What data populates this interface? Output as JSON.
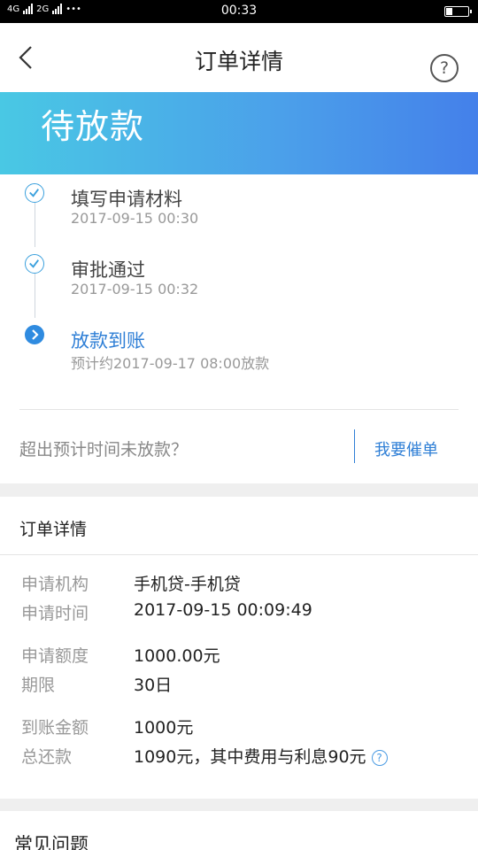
{
  "status_bar": {
    "network_1": "4G",
    "network_2": "2G",
    "more": "•••",
    "time": "00:33"
  },
  "nav": {
    "title": "订单详情",
    "help_icon": "question-circle-icon",
    "back_icon": "chevron-left-icon"
  },
  "banner": {
    "status": "待放款"
  },
  "timeline": [
    {
      "title": "填写申请材料",
      "subtitle": "2017-09-15 00:30",
      "state": "done"
    },
    {
      "title": "审批通过",
      "subtitle": "2017-09-15 00:32",
      "state": "done"
    },
    {
      "title": "放款到账",
      "subtitle": "预计约2017-09-17 08:00放款",
      "state": "active"
    }
  ],
  "urge": {
    "question": "超出预计时间未放款？",
    "button": "我要催单"
  },
  "detail": {
    "header": "订单详情",
    "rows": [
      {
        "label": "申请机构",
        "value": "手机贷-手机贷"
      },
      {
        "label": "申请时间",
        "value": "2017-09-15 00:09:49"
      },
      {
        "label": "申请额度",
        "value": "1000.00元"
      },
      {
        "label": "期限",
        "value": "30日"
      },
      {
        "label": "到账金额",
        "value": "1000元"
      },
      {
        "label": "总还款",
        "value": "1090元，其中费用与利息90元"
      }
    ]
  },
  "faq": {
    "title": "常见问题"
  },
  "colors": {
    "accent": "#2f7fd6",
    "banner_start": "#49c8e4",
    "banner_end": "#4480ea"
  }
}
